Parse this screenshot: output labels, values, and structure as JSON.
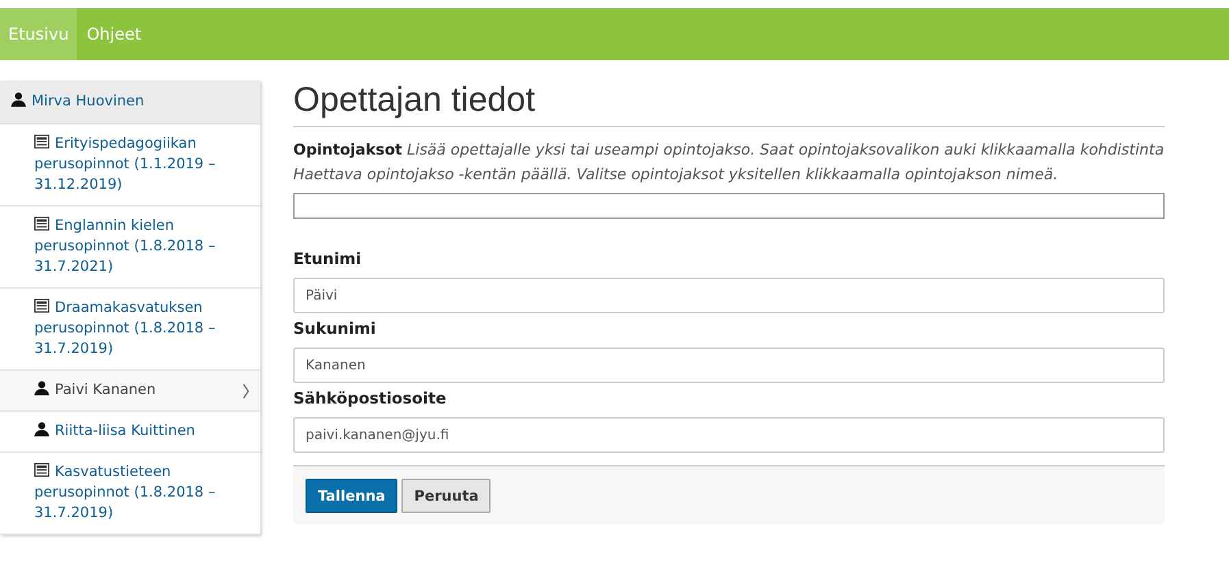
{
  "nav": [
    {
      "label": "Etusivu",
      "selected": true
    },
    {
      "label": "Ohjeet",
      "selected": false
    }
  ],
  "sidebar": {
    "items": [
      {
        "kind": "person",
        "label": "Mirva Huovinen",
        "selected": false,
        "children": [
          {
            "kind": "course",
            "label": "Erityispedagogiikan perusopinnot (1.1.2019 –31.12.2019)",
            "selected": false
          },
          {
            "kind": "course",
            "label": "Englannin kielen perusopinnot (1.8.2018 –31.7.2021)",
            "selected": false
          },
          {
            "kind": "course",
            "label": "Draamakasvatuksen perusopinnot (1.8.2018 –31.7.2019)",
            "selected": false
          },
          {
            "kind": "person",
            "label": "Paivi Kananen",
            "selected": true
          },
          {
            "kind": "person",
            "label": "Riitta-liisa Kuittinen",
            "selected": false
          },
          {
            "kind": "course",
            "label": "Kasvatustieteen perusopinnot (1.8.2018 –31.7.2019)",
            "selected": false
          }
        ]
      }
    ]
  },
  "title": "Opettajan tiedot",
  "courses_field": {
    "label": "Opintojaksot",
    "help": "Lisää opettajalle yksi tai useampi opintojakso. Saat opintojaksovalikon auki klikkaamalla kohdistinta Haettava opintojakso -kentän päällä. Valitse opintojaksot yksitellen klikkaamalla opintojakson nimeä."
  },
  "fields": [
    {
      "label": "Etunimi",
      "value": "Päivi"
    },
    {
      "label": "Sukunimi",
      "value": "Kananen"
    },
    {
      "label": "Sähköpostiosoite",
      "value": "paivi.kananen@jyu.fi"
    }
  ],
  "buttons": [
    {
      "label": "Tallenna",
      "kind": "primary"
    },
    {
      "label": "Peruuta",
      "kind": "default"
    }
  ]
}
